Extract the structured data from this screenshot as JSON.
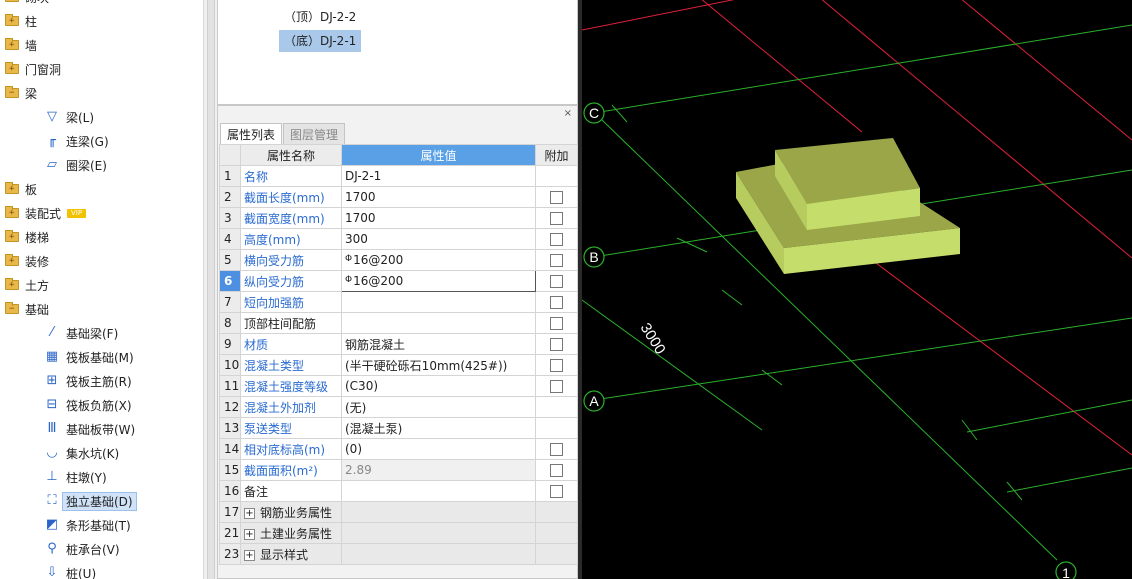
{
  "tree": {
    "top_partial": "砌块",
    "categories": [
      {
        "label": "柱",
        "sign": "+"
      },
      {
        "label": "墙",
        "sign": "+"
      },
      {
        "label": "门窗洞",
        "sign": "+"
      },
      {
        "label": "梁",
        "sign": "−"
      }
    ],
    "beam_items": [
      {
        "label": "梁(L)",
        "icon": "beam-icon"
      },
      {
        "label": "连梁(G)",
        "icon": "coupling-beam-icon"
      },
      {
        "label": "圈梁(E)",
        "icon": "ring-beam-icon"
      }
    ],
    "categories2": [
      {
        "label": "板",
        "sign": "+"
      },
      {
        "label": "装配式",
        "sign": "+",
        "badge": "VIP"
      },
      {
        "label": "楼梯",
        "sign": "+"
      },
      {
        "label": "装修",
        "sign": "+"
      },
      {
        "label": "土方",
        "sign": "+"
      },
      {
        "label": "基础",
        "sign": "−"
      }
    ],
    "foundation_items": [
      {
        "label": "基础梁(F)",
        "icon": "foundation-beam-icon"
      },
      {
        "label": "筏板基础(M)",
        "icon": "raft-foundation-icon"
      },
      {
        "label": "筏板主筋(R)",
        "icon": "raft-main-rebar-icon"
      },
      {
        "label": "筏板负筋(X)",
        "icon": "raft-negative-rebar-icon"
      },
      {
        "label": "基础板带(W)",
        "icon": "foundation-strip-icon"
      },
      {
        "label": "集水坑(K)",
        "icon": "sump-pit-icon"
      },
      {
        "label": "柱墩(Y)",
        "icon": "column-pier-icon"
      },
      {
        "label": "独立基础(D)",
        "icon": "isolated-foundation-icon",
        "selected": true
      },
      {
        "label": "条形基础(T)",
        "icon": "strip-foundation-icon"
      },
      {
        "label": "桩承台(V)",
        "icon": "pile-cap-icon"
      },
      {
        "label": "桩(U)",
        "icon": "pile-icon"
      }
    ]
  },
  "layers": {
    "items": [
      "（顶）DJ-2-2",
      "（底）DJ-2-1"
    ],
    "selected_index": 1
  },
  "props": {
    "close_glyph": "×",
    "tabs": [
      "属性列表",
      "图层管理"
    ],
    "active_tab": 0,
    "headers": {
      "index": "",
      "name": "属性名称",
      "value": "属性值",
      "extra": "附加"
    },
    "rows": [
      {
        "n": "1",
        "name": "名称",
        "value": "DJ-2-1",
        "blue": true,
        "check": false
      },
      {
        "n": "2",
        "name": "截面长度(mm)",
        "value": "1700",
        "blue": true,
        "check": true
      },
      {
        "n": "3",
        "name": "截面宽度(mm)",
        "value": "1700",
        "blue": true,
        "check": true
      },
      {
        "n": "4",
        "name": "高度(mm)",
        "value": "300",
        "blue": true,
        "check": true
      },
      {
        "n": "5",
        "name": "横向受力筋",
        "value": "16@200",
        "phi": "Φ",
        "blue": true,
        "check": true
      },
      {
        "n": "6",
        "name": "纵向受力筋",
        "value": "16@200",
        "phi": "Φ",
        "blue": true,
        "check": true,
        "current": true
      },
      {
        "n": "7",
        "name": "短向加强筋",
        "value": "",
        "blue": true,
        "check": true
      },
      {
        "n": "8",
        "name": "顶部柱间配筋",
        "value": "",
        "blue": false,
        "check": true
      },
      {
        "n": "9",
        "name": "材质",
        "value": "钢筋混凝土",
        "blue": true,
        "check": true
      },
      {
        "n": "10",
        "name": "混凝土类型",
        "value": "(半干硬砼砾石10mm(425#))",
        "blue": true,
        "check": true
      },
      {
        "n": "11",
        "name": "混凝土强度等级",
        "value": "(C30)",
        "blue": true,
        "check": true
      },
      {
        "n": "12",
        "name": "混凝土外加剂",
        "value": "(无)",
        "blue": true,
        "check": false
      },
      {
        "n": "13",
        "name": "泵送类型",
        "value": "(混凝土泵)",
        "blue": true,
        "check": false
      },
      {
        "n": "14",
        "name": "相对底标高(m)",
        "value": "(0)",
        "blue": true,
        "check": true
      },
      {
        "n": "15",
        "name": "截面面积(m²)",
        "value": "2.89",
        "blue": true,
        "check": true,
        "grey": true
      },
      {
        "n": "16",
        "name": "备注",
        "value": "",
        "blue": false,
        "check": true
      }
    ],
    "groups": [
      {
        "n": "17",
        "label": "钢筋业务属性"
      },
      {
        "n": "21",
        "label": "土建业务属性"
      },
      {
        "n": "23",
        "label": "显示样式"
      }
    ],
    "expand_glyph": "+"
  },
  "viewport": {
    "axis_labels": [
      "C",
      "B",
      "A",
      "1"
    ],
    "dimension": "3000",
    "colors": {
      "background": "#000000",
      "red_line": "#e0203a",
      "green_line": "#2bb02b",
      "foundation_top": "#9aa648",
      "foundation_side": "#b6cc5e",
      "foundation_light": "#c5dd6b"
    }
  }
}
